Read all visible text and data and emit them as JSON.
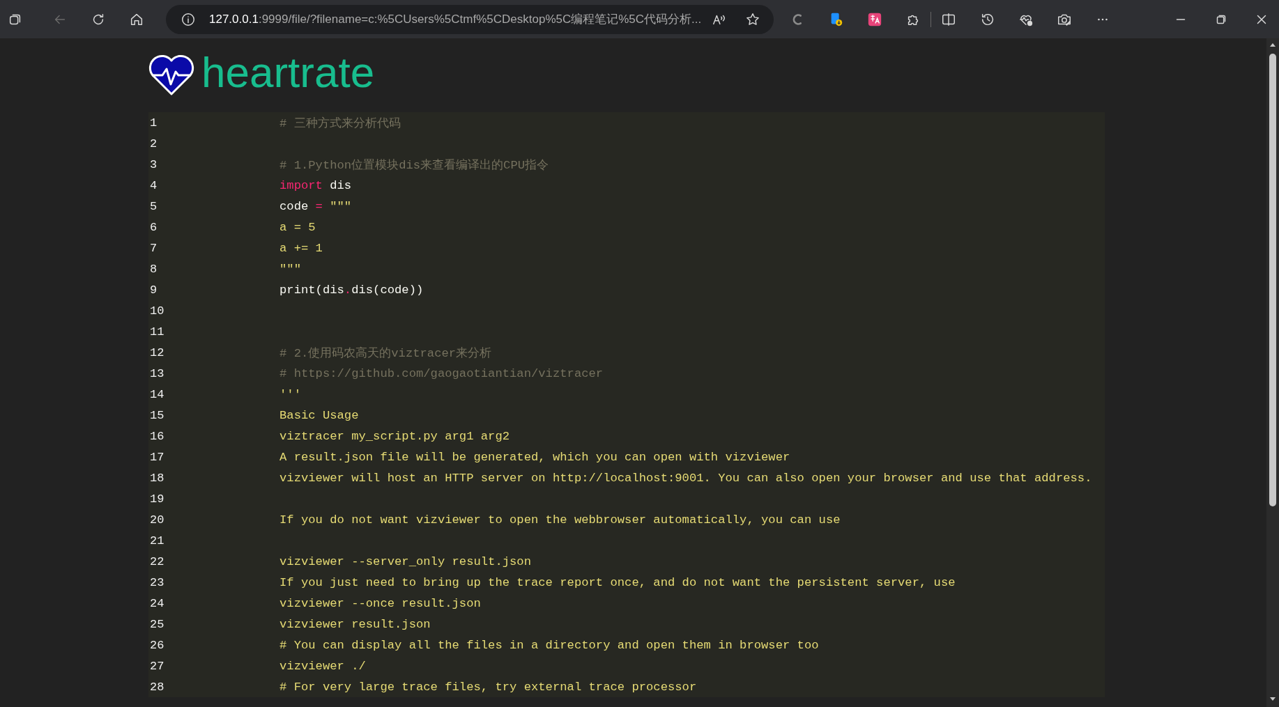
{
  "browser": {
    "back_disabled": true,
    "url_host": "127.0.0.1",
    "url_path": ":9999/file/?filename=c:%5CUsers%5Ctmf%5CDesktop%5C编程笔记%5C代码分析..."
  },
  "logo": {
    "title": "heartrate"
  },
  "code": {
    "lines": [
      {
        "number": "1",
        "tokens": [
          {
            "kind": "comment",
            "text": "# 三种方式来分析代码"
          }
        ]
      },
      {
        "number": "2"
      },
      {
        "number": "3",
        "tokens": [
          {
            "kind": "comment",
            "text": "# 1.Python位置模块dis来查看编译出的CPU指令"
          }
        ]
      },
      {
        "number": "4",
        "tokens": [
          {
            "kind": "keyword",
            "text": "import"
          },
          {
            "kind": "plain",
            "text": " dis"
          }
        ]
      },
      {
        "number": "5",
        "tokens": [
          {
            "kind": "plain",
            "text": "code "
          },
          {
            "kind": "keyword",
            "text": "="
          },
          {
            "kind": "string",
            "text": " \"\"\""
          }
        ]
      },
      {
        "number": "6",
        "tokens": [
          {
            "kind": "string",
            "text": "a = 5"
          }
        ]
      },
      {
        "number": "7",
        "tokens": [
          {
            "kind": "string",
            "text": "a += 1"
          }
        ]
      },
      {
        "number": "8",
        "tokens": [
          {
            "kind": "string",
            "text": "\"\"\""
          }
        ]
      },
      {
        "number": "9",
        "tokens": [
          {
            "kind": "plain",
            "text": "print(dis"
          },
          {
            "kind": "keyword",
            "text": "."
          },
          {
            "kind": "plain",
            "text": "dis(code))"
          }
        ]
      },
      {
        "number": "10"
      },
      {
        "number": "11"
      },
      {
        "number": "12",
        "tokens": [
          {
            "kind": "comment",
            "text": "# 2.使用码农高天的viztracer来分析"
          }
        ]
      },
      {
        "number": "13",
        "tokens": [
          {
            "kind": "comment",
            "text": "# https://github.com/gaogaotiantian/viztracer"
          }
        ]
      },
      {
        "number": "14",
        "tokens": [
          {
            "kind": "string",
            "text": "'''"
          }
        ]
      },
      {
        "number": "15",
        "tokens": [
          {
            "kind": "string",
            "text": "Basic Usage"
          }
        ]
      },
      {
        "number": "16",
        "tokens": [
          {
            "kind": "string",
            "text": "viztracer my_script.py arg1 arg2"
          }
        ]
      },
      {
        "number": "17",
        "tokens": [
          {
            "kind": "string",
            "text": "A result.json file will be generated, which you can open with vizviewer"
          }
        ]
      },
      {
        "number": "18",
        "tokens": [
          {
            "kind": "string",
            "text": "vizviewer will host an HTTP server on http://localhost:9001. You can also open your browser and use that address."
          }
        ]
      },
      {
        "number": "19"
      },
      {
        "number": "20",
        "tokens": [
          {
            "kind": "string",
            "text": "If you do not want vizviewer to open the webbrowser automatically, you can use"
          }
        ]
      },
      {
        "number": "21"
      },
      {
        "number": "22",
        "tokens": [
          {
            "kind": "string",
            "text": "vizviewer --server_only result.json"
          }
        ]
      },
      {
        "number": "23",
        "tokens": [
          {
            "kind": "string",
            "text": "If you just need to bring up the trace report once, and do not want the persistent server, use"
          }
        ]
      },
      {
        "number": "24",
        "tokens": [
          {
            "kind": "string",
            "text": "vizviewer --once result.json"
          }
        ]
      },
      {
        "number": "25",
        "tokens": [
          {
            "kind": "string",
            "text": "vizviewer result.json"
          }
        ]
      },
      {
        "number": "26",
        "tokens": [
          {
            "kind": "string",
            "text": "# You can display all the files in a directory and open them in browser too"
          }
        ]
      },
      {
        "number": "27",
        "tokens": [
          {
            "kind": "string",
            "text": "vizviewer ./"
          }
        ]
      },
      {
        "number": "28",
        "tokens": [
          {
            "kind": "string",
            "text": "# For very large trace files, try external trace processor"
          }
        ]
      }
    ]
  }
}
